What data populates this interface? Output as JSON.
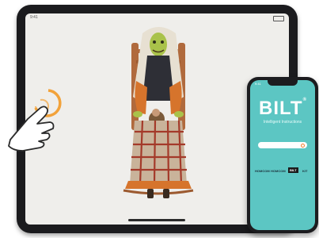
{
  "tablet": {
    "status_time": "9:41"
  },
  "phone": {
    "status_time": "9:41",
    "brand_name": "BILT",
    "brand_reg": "®",
    "tagline": "Intelligent Instructions",
    "search_placeholder": "",
    "brands": [
      "HOMCOM",
      "HOMCOM",
      "BILT",
      "KIT"
    ]
  },
  "colors": {
    "phone_bg": "#5cc6c3",
    "tablet_bg": "#efeeeb",
    "tap_ring": "#f2a23a"
  },
  "icons": [
    "hand-tap-icon",
    "search-icon",
    "battery-icon"
  ]
}
